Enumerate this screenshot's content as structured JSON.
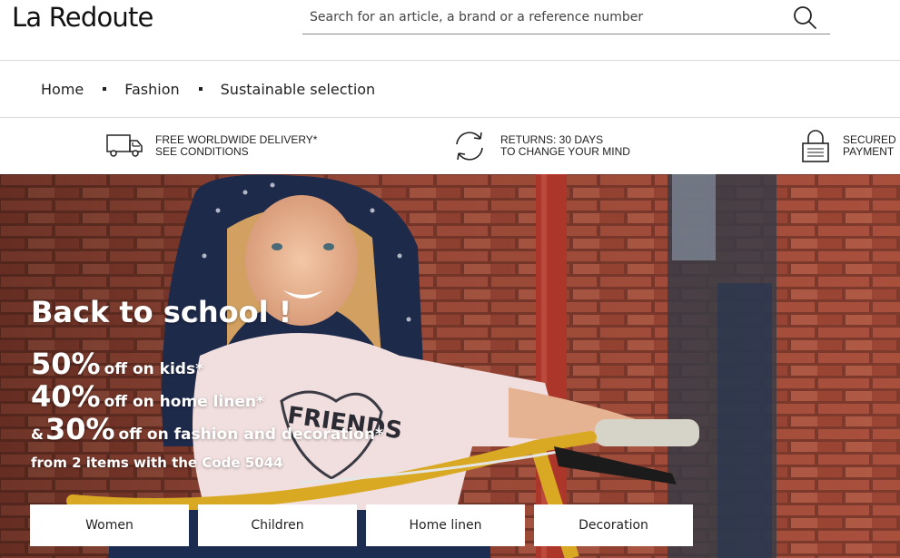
{
  "header": {
    "logo": "La Redoute",
    "search_placeholder": "Search for an article, a brand or a reference number"
  },
  "nav": {
    "items": [
      "Home",
      "Fashion",
      "Sustainable selection"
    ]
  },
  "usp": {
    "delivery": {
      "line1": "FREE WORLDWIDE DELIVERY*",
      "line2": "SEE CONDITIONS",
      "icon": "truck-icon"
    },
    "returns": {
      "line1": "RETURNS: 30 DAYS",
      "line2": "TO CHANGE YOUR MIND",
      "icon": "refresh-icon"
    },
    "payment": {
      "line1": "SECURED",
      "line2": "PAYMENT",
      "icon": "lock-icon"
    }
  },
  "hero": {
    "title": "Back to school !",
    "offers": [
      {
        "prefix": "",
        "percent": "50%",
        "text": "off on kids*"
      },
      {
        "prefix": "",
        "percent": "40%",
        "text": "off on home linen*"
      },
      {
        "prefix": "&",
        "percent": "30%",
        "text": "off on fashion and decoration*"
      }
    ],
    "code_line": "from 2 items with the Code 5044",
    "buttons": [
      "Women",
      "Children",
      "Home linen",
      "Decoration"
    ]
  },
  "colors": {
    "brick": "#9a4a3a",
    "bike_yellow": "#d9a923",
    "text_dark": "#222222"
  }
}
